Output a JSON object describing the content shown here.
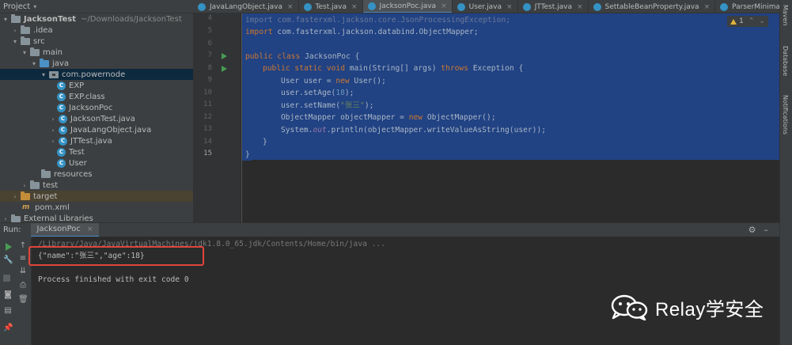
{
  "project": {
    "title": "Project",
    "tree": [
      {
        "label": "JacksonTest",
        "hint": "~/Downloads/JacksonTest",
        "icon": "folder-icon"
      },
      {
        "label": ".idea",
        "icon": "folder-icon"
      },
      {
        "label": "src",
        "icon": "folder-icon"
      },
      {
        "label": "main",
        "icon": "folder-icon"
      },
      {
        "label": "java",
        "icon": "folder-blue-icon"
      },
      {
        "label": "com.powernode",
        "icon": "package-icon"
      },
      {
        "label": "EXP",
        "icon": "class-icon"
      },
      {
        "label": "EXP.class",
        "icon": "class-icon"
      },
      {
        "label": "JacksonPoc",
        "icon": "class-icon"
      },
      {
        "label": "JacksonTest.java",
        "icon": "class-icon"
      },
      {
        "label": "JavaLangObject.java",
        "icon": "class-icon"
      },
      {
        "label": "JTTest.java",
        "icon": "class-icon"
      },
      {
        "label": "Test",
        "icon": "class-icon"
      },
      {
        "label": "User",
        "icon": "class-icon"
      },
      {
        "label": "resources",
        "icon": "folder-res-icon"
      },
      {
        "label": "test",
        "icon": "folder-icon"
      },
      {
        "label": "target",
        "icon": "folder-orange-icon"
      },
      {
        "label": "pom.xml",
        "icon": "maven-icon"
      },
      {
        "label": "External Libraries",
        "icon": "lib-icon"
      }
    ]
  },
  "tabs": [
    {
      "label": "JavaLangObject.java"
    },
    {
      "label": "Test.java"
    },
    {
      "label": "JacksonPoc.java"
    },
    {
      "label": "User.java"
    },
    {
      "label": "JTTest.java"
    },
    {
      "label": "SettableBeanProperty.java"
    },
    {
      "label": "ParserMinimalBase.java"
    }
  ],
  "editor": {
    "line_numbers": [
      "4",
      "5",
      "6",
      "7",
      "8",
      "9",
      "10",
      "11",
      "12",
      "13",
      "14",
      "15"
    ],
    "inspection": {
      "count": "1"
    },
    "code": {
      "l4": "import com.fasterxml.jackson.core.JsonProcessingException;",
      "l5_kw": "import",
      "l5_rest": " com.fasterxml.jackson.databind.ObjectMapper;",
      "l7_kw": "public class",
      "l7_rest": " JacksonPoc {",
      "l8_kw1": "public static void",
      "l8_mid": " main(String[] args) ",
      "l8_kw2": "throws",
      "l8_end": " Exception {",
      "l9_a": "User user = ",
      "l9_kw": "new",
      "l9_b": " User();",
      "l10_a": "user.setAge(",
      "l10_num": "18",
      "l10_b": ");",
      "l11_a": "user.setName(",
      "l11_str": "\"张三\"",
      "l11_b": ");",
      "l12_a": "ObjectMapper objectMapper = ",
      "l12_kw": "new",
      "l12_b": " ObjectMapper();",
      "l13_a": "System.",
      "l13_fld": "out",
      "l13_b": ".println(objectMapper.writeValueAsString(user));",
      "l14": "}",
      "l15": "}"
    }
  },
  "right_strip": [
    "Maven",
    "Database",
    "Notifications"
  ],
  "run": {
    "label": "Run:",
    "tab": "JacksonPoc",
    "console": [
      "/Library/Java/JavaVirtualMachines/jdk1.8.0_65.jdk/Contents/Home/bin/java ...",
      "{\"name\":\"张三\",\"age\":18}",
      "Process finished with exit code 0"
    ]
  },
  "watermark": {
    "text": "Relay学安全"
  },
  "colors": {
    "selection": "#214283",
    "highlight_box": "#e0443c",
    "keyword": "#cc7832",
    "string": "#6a8759",
    "number": "#6897bb"
  }
}
